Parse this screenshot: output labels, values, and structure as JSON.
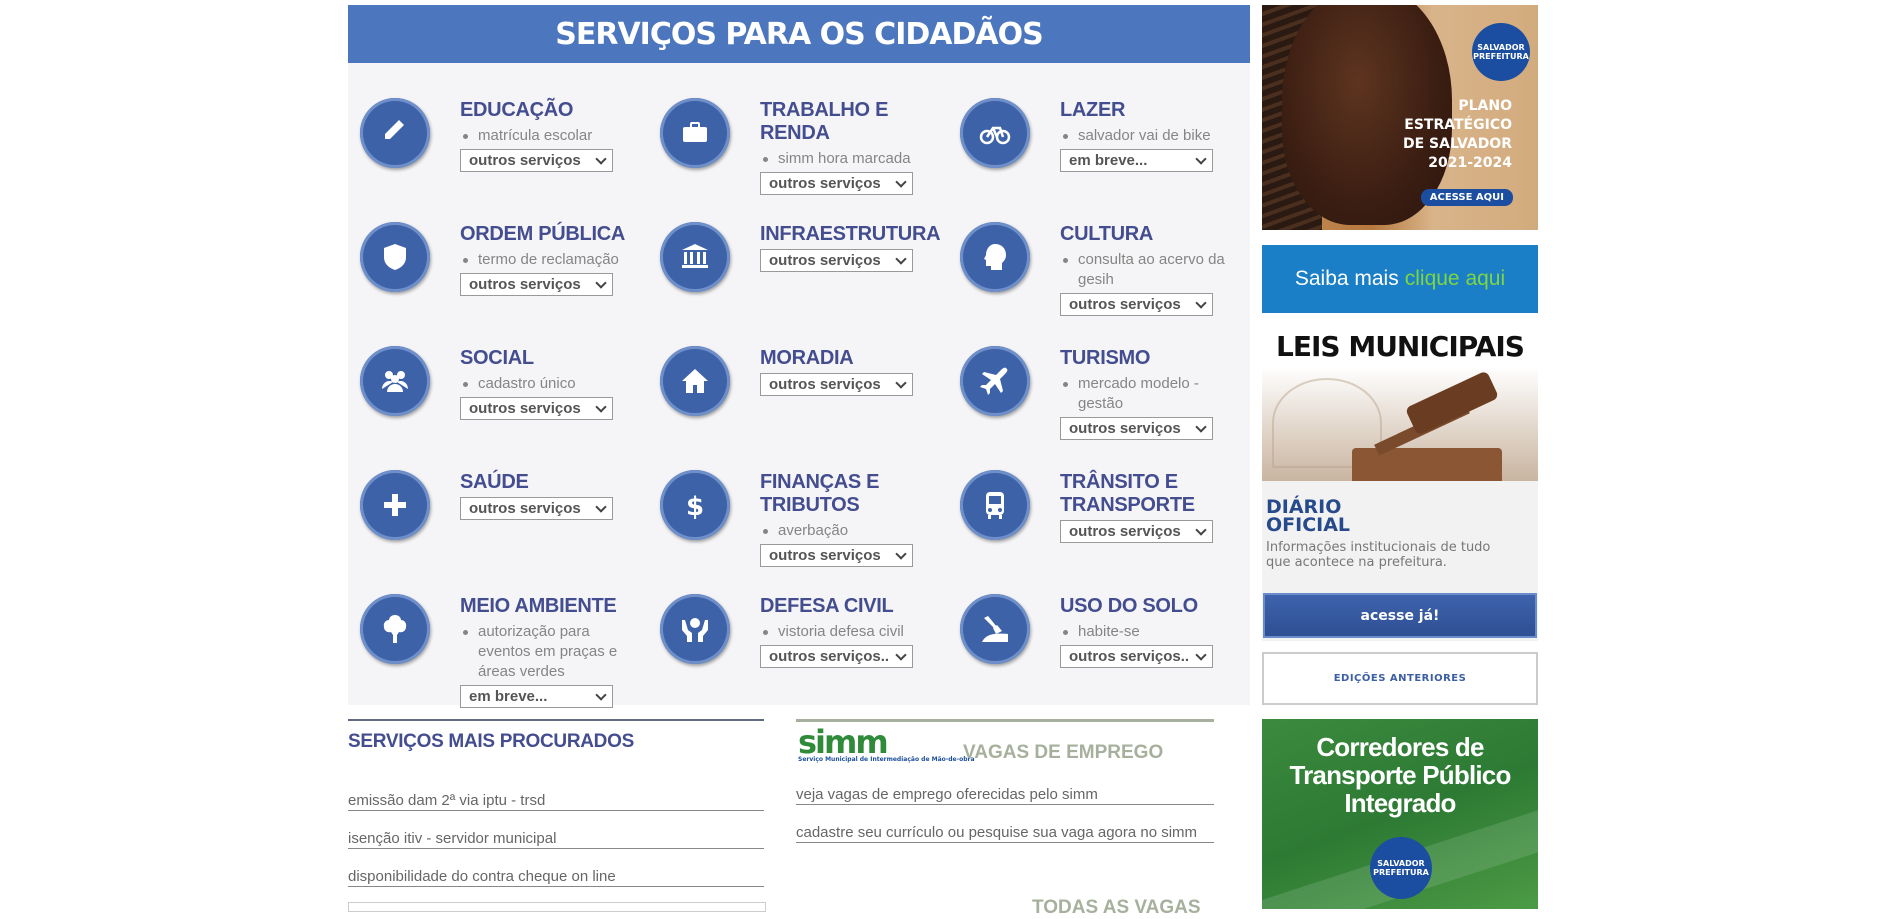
{
  "banner": {
    "title": "SERVIÇOS PARA OS CIDADÃOS"
  },
  "services": [
    {
      "title": "EDUCAÇÃO",
      "item": "matrícula escolar",
      "select": "outros serviços",
      "icon": "pencil-icon"
    },
    {
      "title": "TRABALHO E RENDA",
      "item": "simm hora marcada",
      "select": "outros serviços",
      "icon": "briefcase-icon"
    },
    {
      "title": "LAZER",
      "item": "salvador vai de bike",
      "select": "em breve...",
      "icon": "bicycle-icon"
    },
    {
      "title": "ORDEM PÚBLICA",
      "item": "termo de reclamação",
      "select": "outros serviços",
      "icon": "shield-icon"
    },
    {
      "title": "INFRAESTRUTURA",
      "item": "",
      "select": "outros serviços",
      "icon": "institution-icon"
    },
    {
      "title": "CULTURA",
      "item": "consulta ao acervo da gesih",
      "select": "outros serviços",
      "icon": "head-icon"
    },
    {
      "title": "SOCIAL",
      "item": "cadastro único",
      "select": "outros serviços",
      "icon": "people-icon"
    },
    {
      "title": "MORADIA",
      "item": "",
      "select": "outros serviços",
      "icon": "house-icon"
    },
    {
      "title": "TURISMO",
      "item": "mercado modelo - gestão",
      "select": "outros serviços",
      "icon": "airplane-icon"
    },
    {
      "title": "SAÚDE",
      "item": "",
      "select": "outros serviços",
      "icon": "plus-icon"
    },
    {
      "title": "FINANÇAS E TRIBUTOS",
      "item": "averbação",
      "select": "outros serviços",
      "icon": "dollar-icon"
    },
    {
      "title": "TRÂNSITO E TRANSPORTE",
      "item": "",
      "select": "outros serviços",
      "icon": "bus-icon"
    },
    {
      "title": "MEIO AMBIENTE",
      "item": "autorização para eventos em praças e áreas verdes",
      "select": "em breve...",
      "icon": "tree-icon"
    },
    {
      "title": "DEFESA CIVIL",
      "item": "vistoria defesa civil",
      "select": "outros serviços..",
      "icon": "hands-icon"
    },
    {
      "title": "USO DO SOLO",
      "item": "habite-se",
      "select": "outros serviços..",
      "icon": "shovel-icon"
    }
  ],
  "ads": {
    "plano": {
      "logo": "SALVADOR PREFEITURA",
      "text": "PLANO ESTRATÉGICO DE SALVADOR 2021-2024",
      "button": "ACESSE AQUI"
    },
    "saiba": {
      "text": "Saiba mais",
      "highlight": "clique aqui"
    },
    "leis": {
      "title": "LEIS MUNICIPAIS"
    },
    "diario": {
      "title": "DIÁRIO OFICIAL",
      "subtitle": "Informações institucionais de tudo que acontece na prefeitura.",
      "button": "acesse já!"
    },
    "edicoes": {
      "label": "EDIÇÕES ANTERIORES"
    },
    "corredores": {
      "title": "Corredores de Transporte Público Integrado",
      "logo": "SALVADOR PREFEITURA"
    }
  },
  "most_searched": {
    "title": "SERVIÇOS MAIS PROCURADOS",
    "links": [
      "emissão dam 2ª via iptu - trsd",
      "isenção itiv - servidor municipal",
      "disponibilidade do contra cheque on line"
    ]
  },
  "jobs": {
    "logo": "simm",
    "logo_sub": "Serviço Municipal de Intermediação de Mão-de-obra",
    "title": "VAGAS DE EMPREGO",
    "links": [
      "veja vagas de emprego oferecidas pelo simm",
      "cadastre seu currículo ou pesquise sua vaga agora no simm"
    ],
    "all": "TODAS AS VAGAS"
  }
}
